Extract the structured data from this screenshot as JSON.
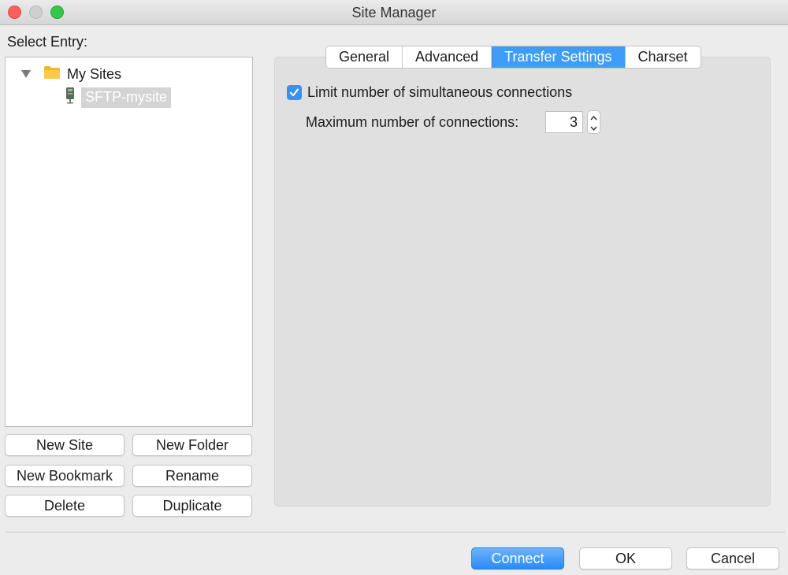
{
  "window": {
    "title": "Site Manager"
  },
  "left": {
    "select_label": "Select Entry:",
    "tree": {
      "folder": {
        "label": "My Sites",
        "icon": "folder-icon"
      },
      "site": {
        "label": "SFTP-mysite",
        "icon": "server-icon"
      }
    },
    "buttons": {
      "new_site": "New Site",
      "new_folder": "New Folder",
      "new_bookmark": "New Bookmark",
      "rename": "Rename",
      "delete": "Delete",
      "duplicate": "Duplicate"
    }
  },
  "tabs": [
    {
      "label": "General"
    },
    {
      "label": "Advanced"
    },
    {
      "label": "Transfer Settings",
      "active": true
    },
    {
      "label": "Charset"
    }
  ],
  "transfer": {
    "limit_label": "Limit number of simultaneous connections",
    "limit_checked": true,
    "max_label": "Maximum number of connections:",
    "max_value": "3"
  },
  "footer": {
    "connect": "Connect",
    "ok": "OK",
    "cancel": "Cancel"
  },
  "colors": {
    "accent": "#3f9cf7",
    "close": "#fc605c",
    "maximize": "#34c84a"
  }
}
